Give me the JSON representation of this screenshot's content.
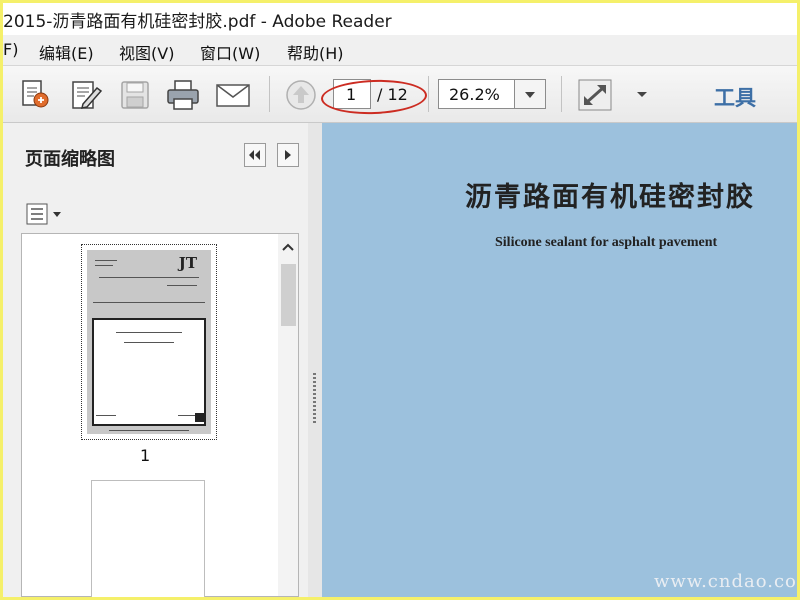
{
  "window": {
    "title": "2015-沥青路面有机硅密封胶.pdf - Adobe Reader"
  },
  "menu": [
    {
      "label": "F)"
    },
    {
      "label": "编辑(E)"
    },
    {
      "label": "视图(V)"
    },
    {
      "label": "窗口(W)"
    },
    {
      "label": "帮助(H)"
    }
  ],
  "toolbar": {
    "icons": [
      "create-pdf-icon",
      "edit-icon",
      "save-icon",
      "print-icon",
      "email-icon",
      "previous-page-icon",
      "fit-window-icon",
      "more-tools-chevron-icon"
    ],
    "page_current": "1",
    "page_total": "/ 12",
    "zoom": "26.2%",
    "tools_label": "工具"
  },
  "navpane": {
    "title": "页面缩略图",
    "thumbnails": [
      {
        "label": "1",
        "mark": "JT"
      },
      {
        "label": ""
      }
    ]
  },
  "document": {
    "title": "沥青路面有机硅密封胶",
    "subtitle": "Silicone sealant for asphalt pavement",
    "watermark": "www.cndao.com"
  },
  "colors": {
    "border": "#f5f06a",
    "doc_background": "#9cc1dd",
    "annotation_oval": "#cc2c22",
    "tools_text": "#3d6fa6"
  }
}
